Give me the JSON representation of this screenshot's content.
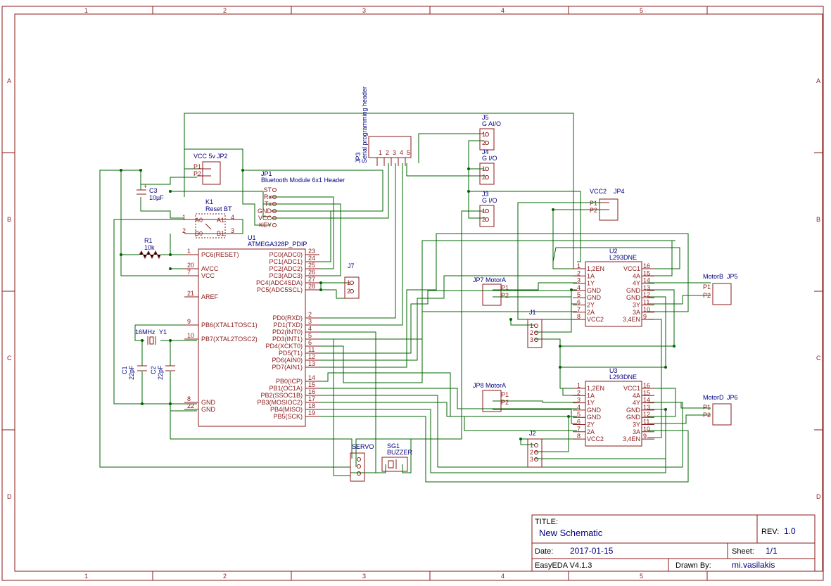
{
  "frame": {
    "cols": [
      "1",
      "2",
      "3",
      "4",
      "5"
    ],
    "rows": [
      "A",
      "B",
      "C",
      "D"
    ]
  },
  "title_block": {
    "title_label": "TITLE:",
    "title": "New Schematic",
    "rev_label": "REV:",
    "rev": "1.0",
    "date_label": "Date:",
    "date": "2017-01-15",
    "sheet_label": "Sheet:",
    "sheet": "1/1",
    "software": "EasyEDA V4.1.3",
    "drawn_label": "Drawn By:",
    "drawn_by": "mi.vasilakis"
  },
  "u1": {
    "ref": "U1",
    "part": "ATMEGA328P_PDIP",
    "left_pins": [
      {
        "num": "1",
        "name": "PC6(RESET)"
      },
      {
        "num": "20",
        "name": "AVCC"
      },
      {
        "num": "7",
        "name": "VCC"
      },
      {
        "num": "21",
        "name": "AREF"
      },
      {
        "num": "9",
        "name": "PB6(XTAL1TOSC1)"
      },
      {
        "num": "10",
        "name": "PB7(XTAL2TOSC2)"
      },
      {
        "num": "8",
        "name": "GND"
      },
      {
        "num": "22",
        "name": "GND"
      }
    ],
    "right_pins": [
      {
        "num": "23",
        "name": "PC0(ADC0)"
      },
      {
        "num": "24",
        "name": "PC1(ADC1)"
      },
      {
        "num": "25",
        "name": "PC2(ADC2)"
      },
      {
        "num": "26",
        "name": "PC3(ADC3)"
      },
      {
        "num": "27",
        "name": "PC4(ADC4SDA)"
      },
      {
        "num": "28",
        "name": "PC5(ADC5SCL)"
      },
      {
        "num": "2",
        "name": "PD0(RXD)"
      },
      {
        "num": "3",
        "name": "PD1(TXD)"
      },
      {
        "num": "4",
        "name": "PD2(INT0)"
      },
      {
        "num": "5",
        "name": "PD3(INT1)"
      },
      {
        "num": "6",
        "name": "PD4(XCKT0)"
      },
      {
        "num": "11",
        "name": "PD5(T1)"
      },
      {
        "num": "12",
        "name": "PD6(AIN0)"
      },
      {
        "num": "13",
        "name": "PD7(AIN1)"
      },
      {
        "num": "14",
        "name": "PB0(ICP)"
      },
      {
        "num": "15",
        "name": "PB1(OC1A)"
      },
      {
        "num": "16",
        "name": "PB2(SSOC1B)"
      },
      {
        "num": "17",
        "name": "PB3(MOSIOC2)"
      },
      {
        "num": "18",
        "name": "PB4(MISO)"
      },
      {
        "num": "19",
        "name": "PB5(SCK)"
      }
    ]
  },
  "u2": {
    "ref": "U2",
    "part": "L293DNE"
  },
  "u3": {
    "ref": "U3",
    "part": "L293DNE"
  },
  "l293_left": [
    {
      "num": "1",
      "name": "1,2EN"
    },
    {
      "num": "2",
      "name": "1A"
    },
    {
      "num": "3",
      "name": "1Y"
    },
    {
      "num": "4",
      "name": "GND"
    },
    {
      "num": "5",
      "name": "GND"
    },
    {
      "num": "6",
      "name": "2Y"
    },
    {
      "num": "7",
      "name": "2A"
    },
    {
      "num": "8",
      "name": "VCC2"
    }
  ],
  "l293_right": [
    {
      "num": "16",
      "name": "VCC1"
    },
    {
      "num": "15",
      "name": "4A"
    },
    {
      "num": "14",
      "name": "4Y"
    },
    {
      "num": "13",
      "name": "GND"
    },
    {
      "num": "12",
      "name": "GND"
    },
    {
      "num": "11",
      "name": "3Y"
    },
    {
      "num": "10",
      "name": "3A"
    },
    {
      "num": "9",
      "name": "3,4EN"
    }
  ],
  "parts": {
    "jp2": {
      "ref": "JP2",
      "value": "VCC 5v",
      "p1": "P1",
      "p2": "P2"
    },
    "c3": {
      "ref": "C3",
      "value": "10µF",
      "plus": "+"
    },
    "k1": {
      "ref": "K1",
      "value": "Reset BT",
      "a0": "A0",
      "a1": "A1",
      "b0": "B0",
      "b1": "B1",
      "n1": "1",
      "n2": "2",
      "n3": "3",
      "n4": "4"
    },
    "r1": {
      "ref": "R1",
      "value": "10k"
    },
    "y1": {
      "ref": "Y1",
      "value": "16MHz"
    },
    "c1": {
      "ref": "C1",
      "value": "22pF"
    },
    "c2": {
      "ref": "C2",
      "value": "22pF"
    },
    "jp1": {
      "ref": "JP1",
      "value": "Bluetooth Module 6x1 Header",
      "pins": [
        "ST",
        "Rx",
        "Tx",
        "GND",
        "VCC",
        "KEY"
      ]
    },
    "jp3": {
      "ref": "JP3",
      "value": "Serial programming header",
      "pins": [
        "1",
        "2",
        "3",
        "4",
        "5"
      ]
    },
    "j5": {
      "ref": "J5",
      "value": "G AI/O"
    },
    "j4": {
      "ref": "J4",
      "value": "G I/O"
    },
    "j3": {
      "ref": "J3",
      "value": "G I/O"
    },
    "jp4": {
      "ref": "JP4",
      "value": "VCC2",
      "p1": "P1",
      "p2": "P2"
    },
    "j7": {
      "ref": "J7",
      "n1": "1",
      "n2": "2"
    },
    "jp7": {
      "ref": "JP7",
      "value": "MotorA",
      "p1": "P1",
      "p2": "P2"
    },
    "jp8": {
      "ref": "JP8",
      "value": "MotorA",
      "p1": "P1",
      "p2": "P2"
    },
    "jp5": {
      "ref": "JP5",
      "value": "MotorB",
      "p1": "P1",
      "p2": "P2"
    },
    "jp6": {
      "ref": "JP6",
      "value": "MotorD",
      "p1": "P1",
      "p2": "P2"
    },
    "j1": {
      "ref": "J1",
      "pins": [
        "1",
        "2",
        "3"
      ]
    },
    "j2": {
      "ref": "J2",
      "pins": [
        "1",
        "2",
        "3"
      ]
    },
    "servo": {
      "ref": "SERVO"
    },
    "sg1": {
      "ref": "SG1",
      "value": "BUZZER"
    },
    "two_pin": [
      "1",
      "2"
    ]
  }
}
